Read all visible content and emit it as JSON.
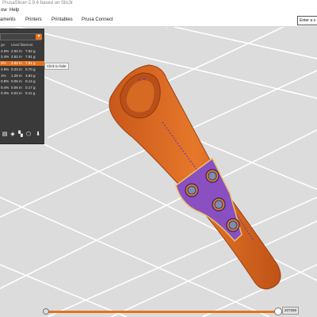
{
  "window": {
    "title": "PrusaSlicer-2.9.4 based on Slic3r"
  },
  "menu": {
    "items": [
      "ow",
      "Help"
    ]
  },
  "tabs": {
    "items": [
      "aments",
      "Printers",
      "Printables",
      "Prusa Connect"
    ]
  },
  "search": {
    "value": "Enter a s"
  },
  "legend": {
    "headers": [
      "ge",
      "Used filament"
    ],
    "rows": [
      {
        "pct": "4.5%",
        "length": "2.52 m",
        "weight": "7.52 g"
      },
      {
        "pct": "2.4%",
        "length": "2.62 m",
        "weight": "7.81 g"
      },
      {
        "pct": "2%",
        "length": "2.62 m",
        "weight": "7.81 g"
      },
      {
        "pct": "4.8%",
        "length": "0.23 m",
        "weight": "0.70 g"
      },
      {
        "pct": "1%",
        "length": "1.28 m",
        "weight": "3.83 g"
      },
      {
        "pct": "0.8%",
        "length": "0.05 m",
        "weight": "0.14 g"
      },
      {
        "pct": "0.4%",
        "length": "0.06 m",
        "weight": "0.17 g"
      },
      {
        "pct": "0.3%",
        "length": "0.04 m",
        "weight": "0.11 g"
      }
    ],
    "selected_index": 2,
    "tooltip": "Click to hide"
  },
  "slider": {
    "value_label": "207268",
    "position": 0.96
  },
  "colors": {
    "accent": "#e8721c",
    "model_orange": "#e06d1f",
    "panel_purple": "#8a4fc0",
    "viewport_bg": "#dcdcdc"
  },
  "icons": [
    "dropdown-arrow-icon",
    "layers-icon",
    "cube-icon",
    "checker-icon",
    "shapes-icon",
    "arrow-down-icon"
  ]
}
